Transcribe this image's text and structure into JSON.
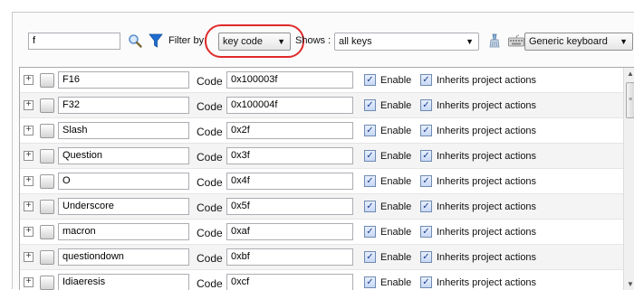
{
  "toolbar": {
    "search_value": "f",
    "filter_label": "Filter by:",
    "filter_value": "key code",
    "shows_label": "Shows :",
    "shows_value": "all keys",
    "keyboard_value": "Generic keyboard"
  },
  "table": {
    "code_label": "Code",
    "enable_label": "Enable",
    "inherit_label": "Inherits project actions",
    "rows": [
      {
        "name": "F16",
        "code": "0x100003f",
        "enabled": true,
        "inherits": true
      },
      {
        "name": "F32",
        "code": "0x100004f",
        "enabled": true,
        "inherits": true
      },
      {
        "name": "Slash",
        "code": "0x2f",
        "enabled": true,
        "inherits": true
      },
      {
        "name": "Question",
        "code": "0x3f",
        "enabled": true,
        "inherits": true
      },
      {
        "name": "O",
        "code": "0x4f",
        "enabled": true,
        "inherits": true
      },
      {
        "name": "Underscore",
        "code": "0x5f",
        "enabled": true,
        "inherits": true
      },
      {
        "name": "macron",
        "code": "0xaf",
        "enabled": true,
        "inherits": true
      },
      {
        "name": "questiondown",
        "code": "0xbf",
        "enabled": true,
        "inherits": true
      },
      {
        "name": "Idiaeresis",
        "code": "0xcf",
        "enabled": true,
        "inherits": true
      }
    ]
  },
  "icons": {
    "search": "search-icon",
    "filter": "filter-funnel-icon",
    "clear": "clear-brush-icon",
    "keyboard": "keyboard-icon",
    "expand": "plus-expand-icon"
  },
  "colors": {
    "highlight": "#e02a2a",
    "filter_icon": "#1f6fd1",
    "check": "#1d3f8a"
  }
}
